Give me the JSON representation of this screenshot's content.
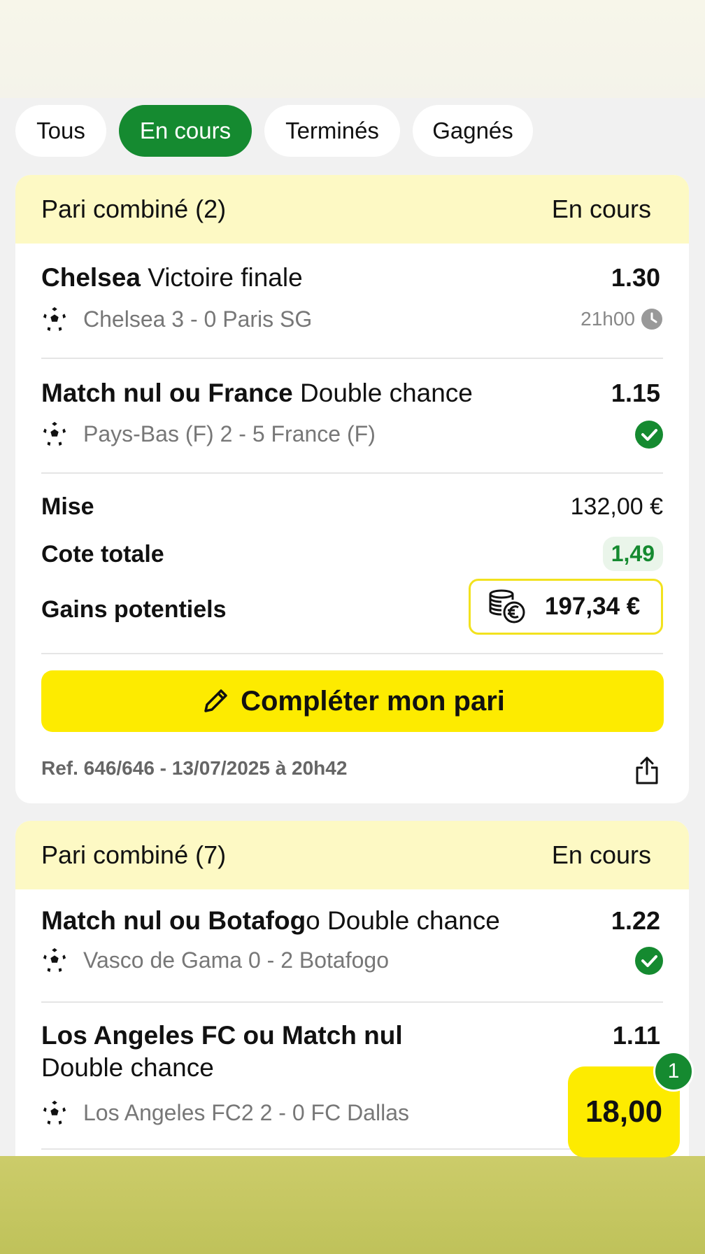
{
  "tabs": [
    {
      "label": "Tous",
      "active": false
    },
    {
      "label": "En cours",
      "active": true
    },
    {
      "label": "Terminés",
      "active": false
    },
    {
      "label": "Gagnés",
      "active": false
    }
  ],
  "card1": {
    "title": "Pari combiné (2)",
    "status": "En cours",
    "selections": [
      {
        "team_bold": "Chelsea",
        "market": " Victoire finale",
        "odds": "1.30",
        "match": "Chelsea 3 - 0 Paris SG",
        "time": "21h00",
        "icon": "clock-icon"
      },
      {
        "team_bold": "Match nul ou France",
        "market": " Double chance",
        "odds": "1.15",
        "match": "Pays-Bas (F) 2 - 5 France (F)",
        "icon": "check-icon"
      }
    ],
    "summary": {
      "stake_label": "Mise",
      "stake_value": "132,00 €",
      "total_odds_label": "Cote totale",
      "total_odds_value": "1,49",
      "gains_label": "Gains potentiels",
      "gains_value": "197,34 €"
    },
    "complete_button": "Compléter mon pari",
    "ref": "Ref. 646/646 - 13/07/2025 à 20h42"
  },
  "card2": {
    "title": "Pari combiné (7)",
    "status": "En cours",
    "selections": [
      {
        "team_bold": "Match nul ou Botafog",
        "team_rest": "o",
        "market": " Double chance",
        "odds": "1.22",
        "match": "Vasco de Gama 0 - 2 Botafogo",
        "icon": "check-icon"
      },
      {
        "team_bold": "Los Angeles FC ou Match nul",
        "market": "Double chance",
        "odds": "1.11",
        "match": "Los Angeles FC2 2 - 0 FC Dallas"
      }
    ]
  },
  "betslip": {
    "total": "18,00",
    "count": "1"
  },
  "colors": {
    "accent_green": "#158a30",
    "brand_yellow": "#fdeb00",
    "header_yellow": "#fdf9c4"
  }
}
